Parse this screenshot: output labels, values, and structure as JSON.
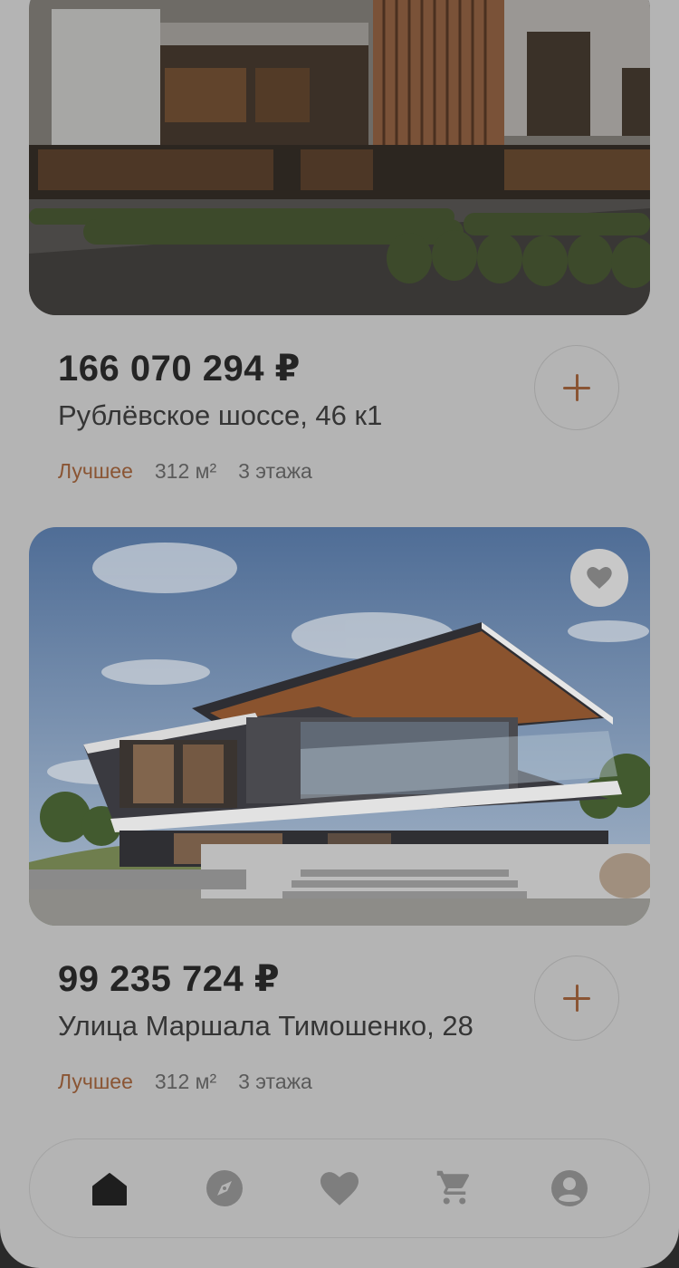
{
  "listings": [
    {
      "price": "166 070 294 ₽",
      "address": "Рублёвское шоссе, 46 к1",
      "tag": "Лучшее",
      "area": "312 м²",
      "floors": "3 этажа"
    },
    {
      "price": "99 235 724 ₽",
      "address": "Улица Маршала Тимошенко, 28",
      "tag": "Лучшее",
      "area": "312 м²",
      "floors": "3 этажа",
      "favorite": true
    }
  ],
  "nav": {
    "active": "home",
    "items": [
      "home-icon",
      "compass-icon",
      "heart-icon",
      "cart-icon",
      "profile-icon"
    ]
  },
  "colors": {
    "accent": "#8a5534",
    "overlay_background": "#b4b4b4",
    "text_primary": "#242424",
    "icon_inactive": "#7e7e7e"
  }
}
